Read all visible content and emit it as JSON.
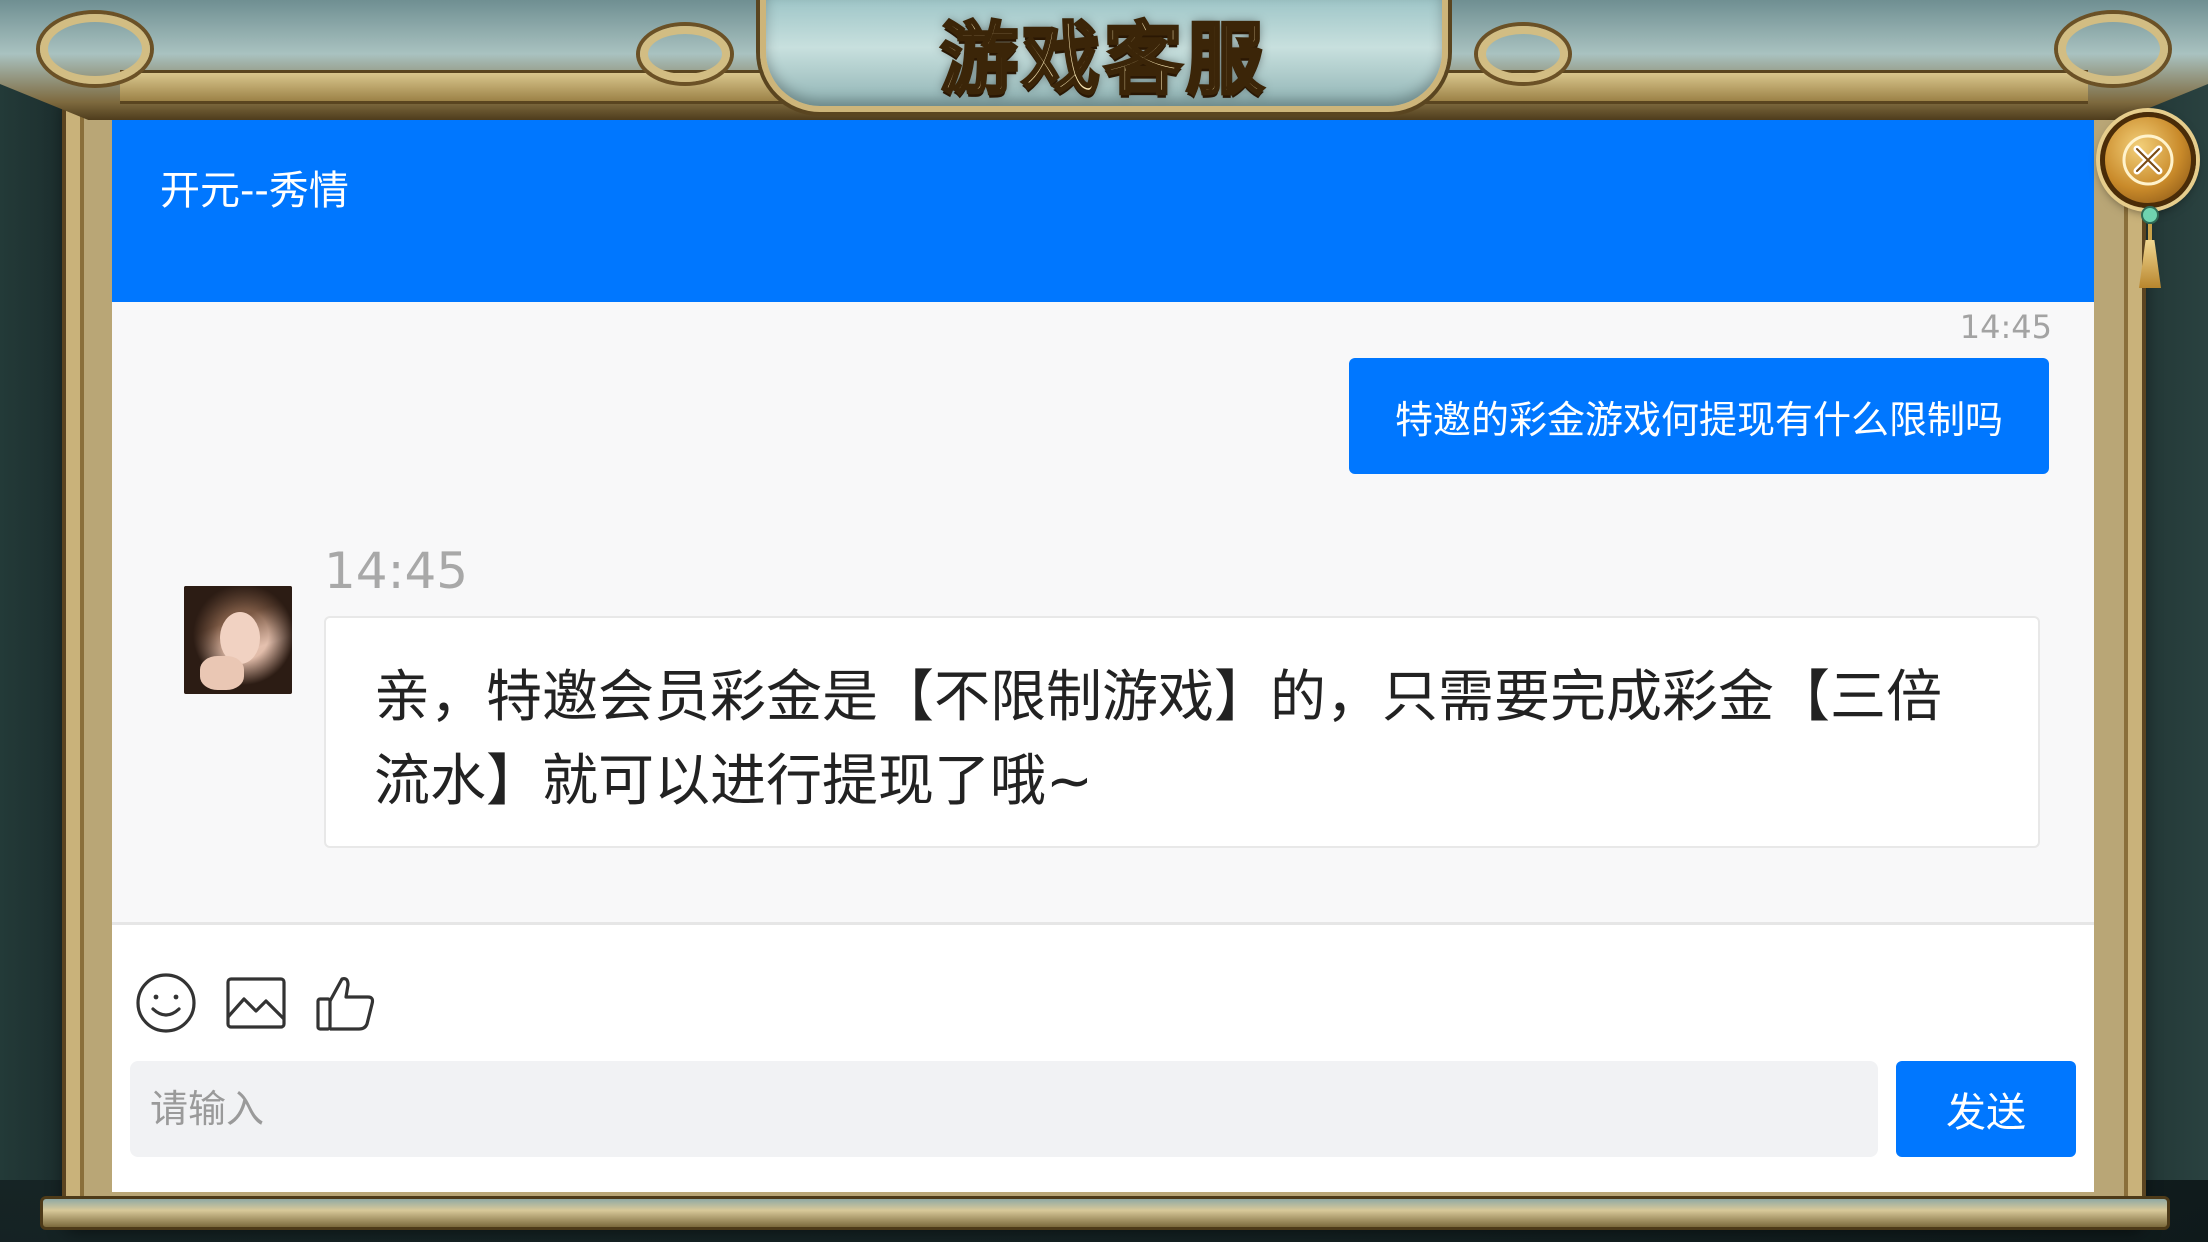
{
  "window": {
    "title": "游戏客服",
    "close_icon": "close-x-icon"
  },
  "chat": {
    "agent_name": "开元--秀情",
    "header_color": "#0077ff",
    "messages": [
      {
        "side": "right",
        "time": "14:45",
        "text": "特邀的彩金游戏何提现有什么限制吗"
      },
      {
        "side": "left",
        "time": "14:45",
        "avatar": "agent-avatar",
        "text": "亲，特邀会员彩金是【不限制游戏】的，只需要完成彩金【三倍流水】就可以进行提现了哦~"
      }
    ]
  },
  "composer": {
    "tools": [
      "smiley-icon",
      "image-icon",
      "thumbs-up-icon"
    ],
    "input_placeholder": "请输入",
    "input_value": "",
    "send_label": "发送"
  }
}
